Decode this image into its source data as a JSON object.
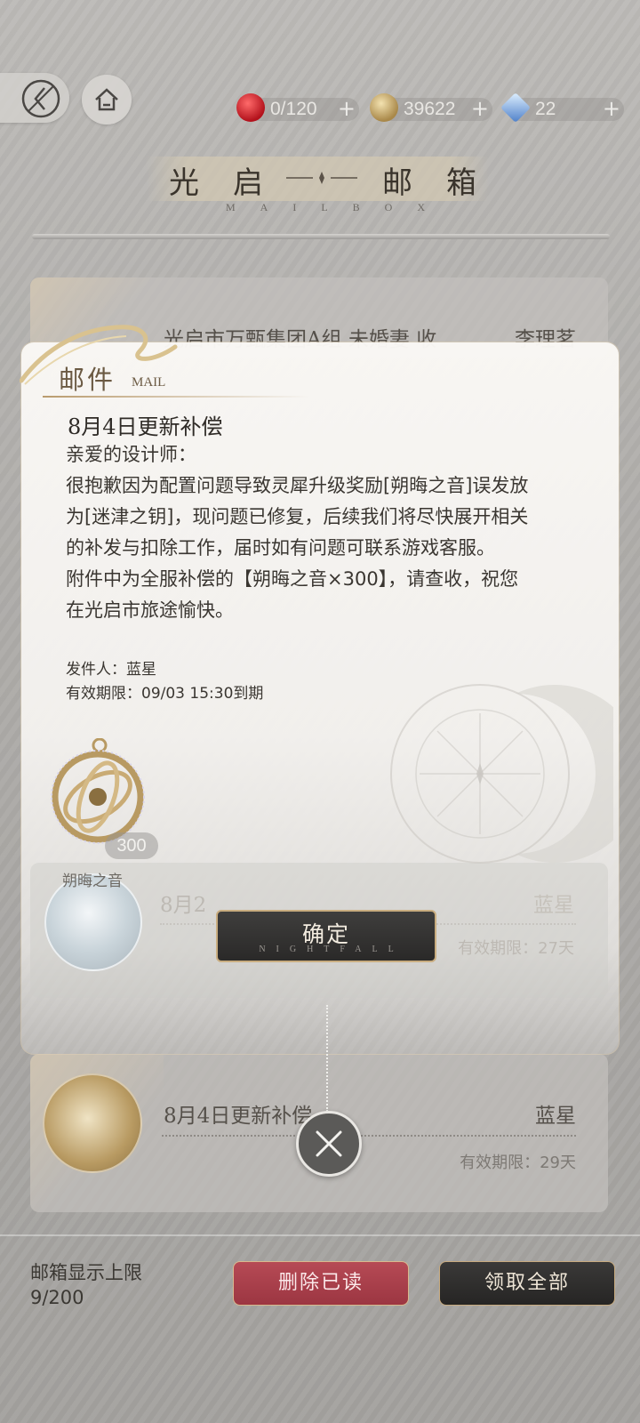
{
  "resources": [
    {
      "icon": "apple-energy-icon",
      "value": "0/120",
      "plus": "+"
    },
    {
      "icon": "gold-coin-icon",
      "value": "39622",
      "plus": "+"
    },
    {
      "icon": "blue-crystal-icon",
      "value": "22",
      "plus": "+"
    }
  ],
  "header": {
    "title_left": "光　启",
    "title_right": "邮　箱",
    "subtitle": "MAILBOX"
  },
  "list": [
    {
      "subject": "光启市万甄集团A组 未婚妻 收",
      "sender": "李理茗",
      "valid": ""
    },
    {
      "subject": "8月2",
      "sender": "蓝星",
      "valid": "有效期限：27天"
    },
    {
      "subject": "8月4日更新补偿",
      "sender": "蓝星",
      "valid": "有效期限：29天"
    }
  ],
  "modal": {
    "tab": "邮件",
    "tab_sub": "MAIL",
    "title": "8月4日更新补偿",
    "greeting": "亲爱的设计师：",
    "body_lines": [
      "很抱歉因为配置问题导致灵犀升级奖励[朔晦之音]误发放",
      "为[迷津之钥]，现问题已修复，后续我们将尽快展开相关",
      "的补发与扣除工作，届时如有问题可联系游戏客服。",
      "附件中为全服补偿的【朔晦之音×300】，请查收，祝您",
      "在光启市旅途愉快。"
    ],
    "sender_line": "发件人：蓝星",
    "expire_line": "有效期限：09/03 15:30到期",
    "attachment": {
      "name": "朔晦之音",
      "count": "300"
    },
    "ok_label": "确定",
    "ok_sub": "NIGHTFALL"
  },
  "bottom": {
    "limit_label": "邮箱显示上限",
    "limit_value": "9/200",
    "delete_label": "删除已读",
    "claim_label": "领取全部"
  }
}
